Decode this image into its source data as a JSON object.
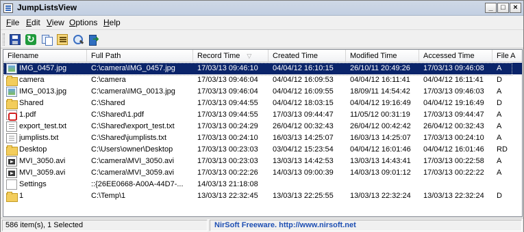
{
  "window": {
    "title": "JumpListsView"
  },
  "menu": [
    {
      "label": "File",
      "u": "F",
      "rest": "ile"
    },
    {
      "label": "Edit",
      "u": "E",
      "rest": "dit"
    },
    {
      "label": "View",
      "u": "V",
      "rest": "iew"
    },
    {
      "label": "Options",
      "u": "O",
      "rest": "ptions"
    },
    {
      "label": "Help",
      "u": "H",
      "rest": "elp"
    }
  ],
  "toolbar": [
    {
      "name": "save-icon"
    },
    {
      "name": "refresh-icon"
    },
    {
      "name": "copy-icon"
    },
    {
      "name": "properties-icon"
    },
    {
      "name": "find-icon"
    },
    {
      "name": "exit-icon"
    }
  ],
  "columns": [
    "Filename",
    "Full Path",
    "Record Time",
    "Created Time",
    "Modified Time",
    "Accessed Time",
    "File A"
  ],
  "sort_column": "Record Time",
  "rows": [
    {
      "icon": "image",
      "cells": [
        "IMG_0457.jpg",
        "C:\\camera\\IMG_0457.jpg",
        "17/03/13 09:46:10",
        "04/04/12 16:10:15",
        "26/10/11 20:49:26",
        "17/03/13 09:46:08",
        "A"
      ],
      "selected": true
    },
    {
      "icon": "folder",
      "cells": [
        "camera",
        "C:\\camera",
        "17/03/13 09:46:04",
        "04/04/12 16:09:53",
        "04/04/12 16:11:41",
        "04/04/12 16:11:41",
        "D"
      ]
    },
    {
      "icon": "image",
      "cells": [
        "IMG_0013.jpg",
        "C:\\camera\\IMG_0013.jpg",
        "17/03/13 09:46:04",
        "04/04/12 16:09:55",
        "18/09/11 14:54:42",
        "17/03/13 09:46:03",
        "A"
      ]
    },
    {
      "icon": "folder",
      "cells": [
        "Shared",
        "C:\\Shared",
        "17/03/13 09:44:55",
        "04/04/12 18:03:15",
        "04/04/12 19:16:49",
        "04/04/12 19:16:49",
        "D"
      ]
    },
    {
      "icon": "pdf",
      "cells": [
        "1.pdf",
        "C:\\Shared\\1.pdf",
        "17/03/13 09:44:55",
        "17/03/13 09:44:47",
        "11/05/12 00:31:19",
        "17/03/13 09:44:47",
        "A"
      ]
    },
    {
      "icon": "doc",
      "cells": [
        "export_test.txt",
        "C:\\Shared\\export_test.txt",
        "17/03/13 00:24:29",
        "26/04/12 00:32:43",
        "26/04/12 00:42:42",
        "26/04/12 00:32:43",
        "A"
      ]
    },
    {
      "icon": "doc",
      "cells": [
        "jumplists.txt",
        "C:\\Shared\\jumplists.txt",
        "17/03/13 00:24:10",
        "16/03/13 14:25:07",
        "16/03/13 14:25:07",
        "17/03/13 00:24:10",
        "A"
      ]
    },
    {
      "icon": "folder",
      "cells": [
        "Desktop",
        "C:\\Users\\owner\\Desktop",
        "17/03/13 00:23:03",
        "03/04/12 15:23:54",
        "04/04/12 16:01:46",
        "04/04/12 16:01:46",
        "RD"
      ]
    },
    {
      "icon": "video",
      "cells": [
        "MVI_3050.avi",
        "C:\\camera\\MVI_3050.avi",
        "17/03/13 00:23:03",
        "13/03/13 14:42:53",
        "13/03/13 14:43:41",
        "17/03/13 00:22:58",
        "A"
      ]
    },
    {
      "icon": "video",
      "cells": [
        "MVI_3059.avi",
        "C:\\camera\\MVI_3059.avi",
        "17/03/13 00:22:26",
        "14/03/13 09:00:39",
        "14/03/13 09:01:12",
        "17/03/13 00:22:22",
        "A"
      ]
    },
    {
      "icon": "blank",
      "cells": [
        "Settings",
        "::{26EE0668-A00A-44D7-...",
        "14/03/13 21:18:08",
        "",
        "",
        "",
        ""
      ]
    },
    {
      "icon": "folder",
      "cells": [
        "1",
        "C:\\Temp\\1",
        "13/03/13 22:32:45",
        "13/03/13 22:25:55",
        "13/03/13 22:32:24",
        "13/03/13 22:32:24",
        "D"
      ]
    }
  ],
  "status": {
    "items": "586 item(s), 1 Selected",
    "credit": "NirSoft Freeware.  http://www.nirsoft.net"
  }
}
